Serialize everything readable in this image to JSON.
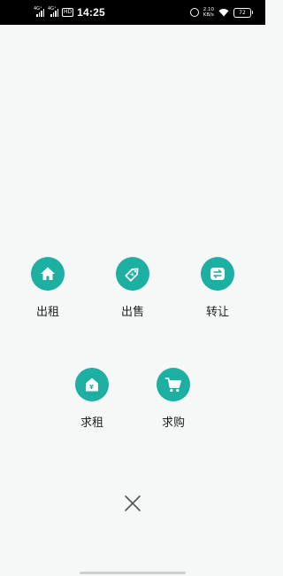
{
  "status_bar": {
    "signal_1_label": "4G⁺",
    "signal_2_label": "4G⁺",
    "hd_badge": "HD",
    "time": "14:25",
    "net_speed_value": "2.10",
    "net_speed_unit": "KB/s",
    "battery": "72",
    "icons": [
      "alarm-icon",
      "wifi-icon",
      "battery-icon"
    ]
  },
  "actions": {
    "row1": [
      {
        "label": "出租",
        "icon": "house-icon"
      },
      {
        "label": "出售",
        "icon": "price-tag-icon"
      },
      {
        "label": "转让",
        "icon": "swap-arrows-icon"
      }
    ],
    "row2": [
      {
        "label": "求租",
        "icon": "house-yen-icon"
      },
      {
        "label": "求购",
        "icon": "shopping-cart-icon"
      }
    ]
  },
  "close_icon": "close-icon",
  "colors": {
    "accent": "#1eafa3",
    "background": "#f6f7f7",
    "status_bar": "#000000"
  }
}
